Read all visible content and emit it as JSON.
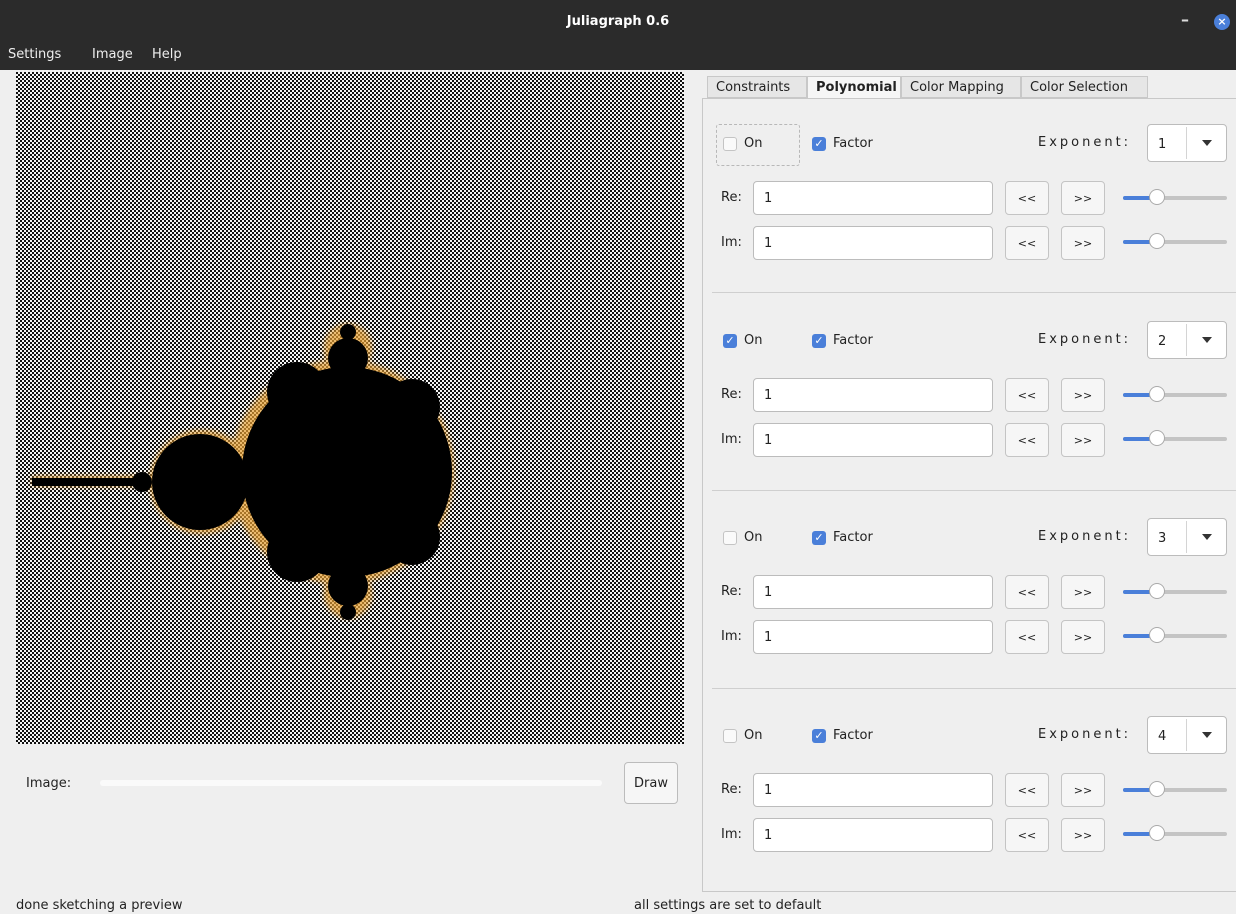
{
  "window": {
    "title": "Juliagraph 0.6"
  },
  "menu": [
    "Settings",
    "Image",
    "Help"
  ],
  "tabs": [
    {
      "label": "Constraints",
      "active": false
    },
    {
      "label": "Polynomial",
      "active": true
    },
    {
      "label": "Color Mapping",
      "active": false
    },
    {
      "label": "Color Selection",
      "active": false
    }
  ],
  "preview": {
    "image_label": "Image:",
    "progress": 0,
    "draw_label": "Draw"
  },
  "labels": {
    "on": "On",
    "factor": "Factor",
    "exponent": "Exponent:",
    "re": "Re:",
    "im": "Im:",
    "back": "<<",
    "fwd": ">>"
  },
  "monomials": [
    {
      "on": false,
      "factor": true,
      "exponent": "1",
      "re": "1",
      "im": "1",
      "re_level": 0.3,
      "im_level": 0.3
    },
    {
      "on": true,
      "factor": true,
      "exponent": "2",
      "re": "1",
      "im": "1",
      "re_level": 0.3,
      "im_level": 0.3
    },
    {
      "on": false,
      "factor": true,
      "exponent": "3",
      "re": "1",
      "im": "1",
      "re_level": 0.3,
      "im_level": 0.3
    },
    {
      "on": false,
      "factor": true,
      "exponent": "4",
      "re": "1",
      "im": "1",
      "re_level": 0.3,
      "im_level": 0.3
    }
  ],
  "status": {
    "left": "done sketching a preview",
    "right": "all settings are set to default"
  },
  "colors": {
    "accent": "#4a7fd9",
    "fractal_edge": "#e8a030",
    "titlebar": "#2b2b2b"
  }
}
